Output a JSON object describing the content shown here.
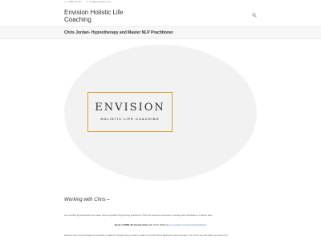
{
  "topbar": {
    "phone": "0 7838 671 321",
    "email": "info@envisionhlc.co.uk",
    "phone_icon": "phone-icon",
    "email_icon": "envelope-icon"
  },
  "header": {
    "site_title": "Envision Holistic Life Coaching",
    "search_icon": "search-icon"
  },
  "page": {
    "title": "Chris Jordan- Hypnotherapy and Master NLP Practitioner"
  },
  "logo": {
    "word": "ENVISION",
    "subtitle": "HOLISTIC LIFE COACHING",
    "accent": "#d4a237"
  },
  "content": {
    "heading": "Working with Chris –",
    "intro": "As a certified hypnotherapist and master Neuro-Linguistic Programming practitioner, Chris has extensive experience in working with individuals on a deeper level.",
    "book_bold": "Book a FREE 30 minute Chat",
    "book_mid": " with Chris NOW at ",
    "book_link": "go.oncehub.com/envisionworkshop",
    "bottom": "Discover how of hypnotherapy it is possible to make the changes that you want to make in your life without fighting the same old ways. The current you and where you want to be."
  }
}
